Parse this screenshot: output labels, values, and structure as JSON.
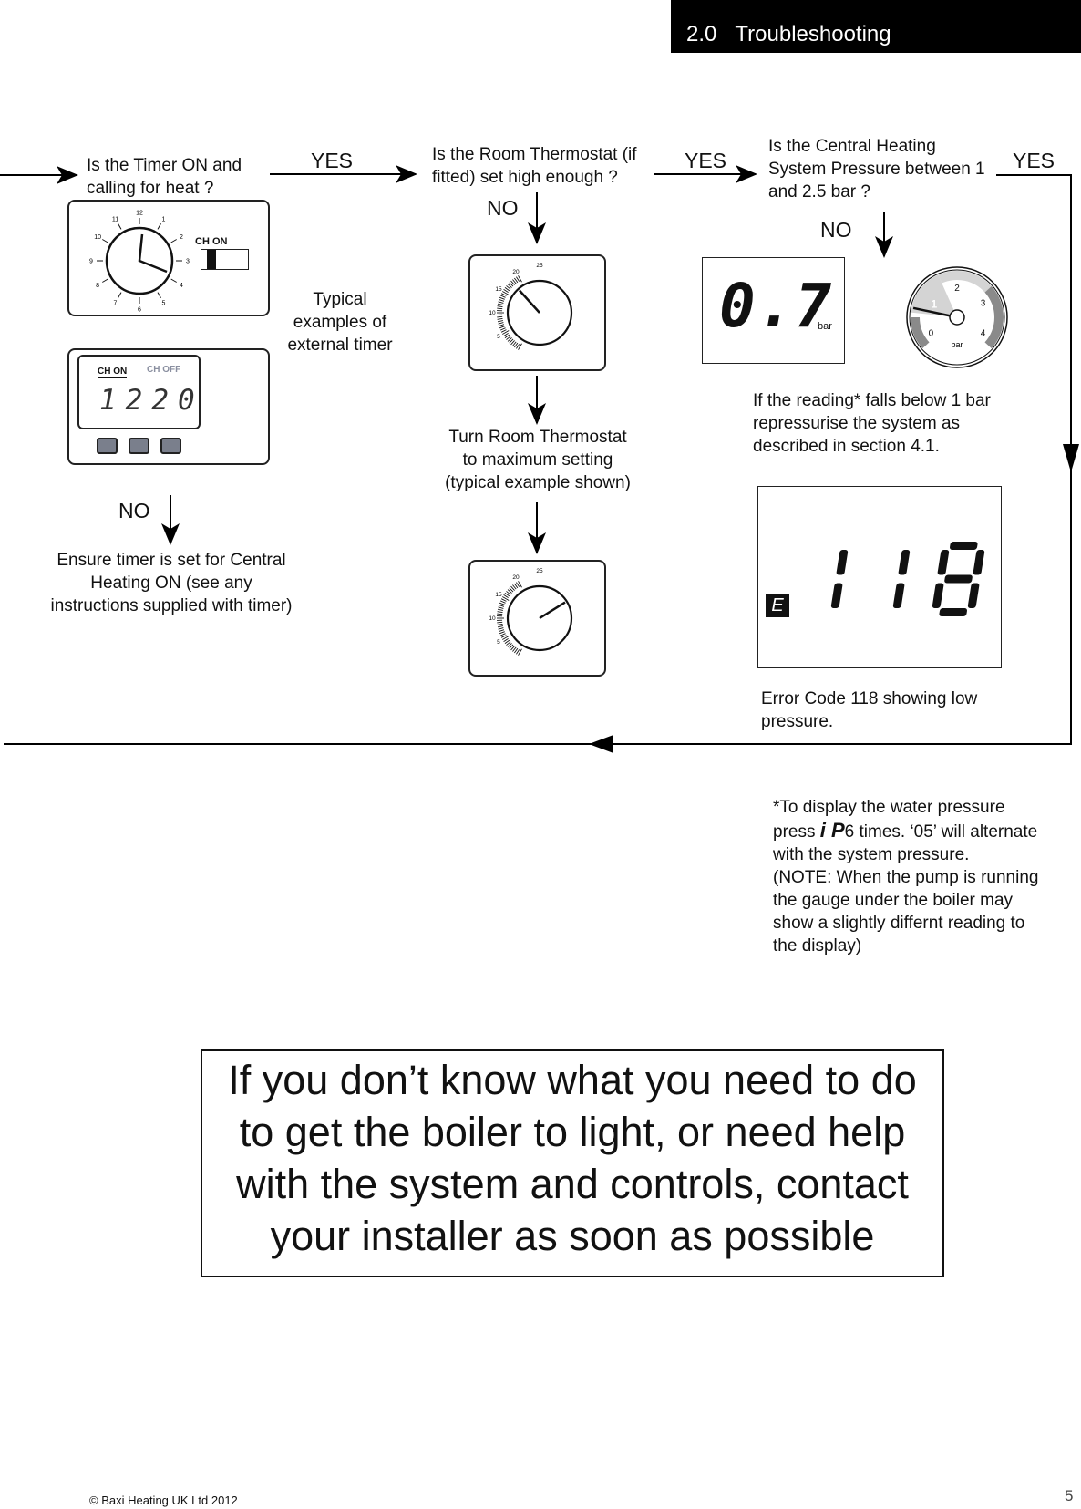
{
  "header": {
    "section": "2.0",
    "title": "Troubleshooting"
  },
  "flow": {
    "yes": "YES",
    "no": "NO",
    "timer": {
      "question": [
        "Is the Timer ON and",
        "calling for heat ?"
      ],
      "caption": [
        "Typical",
        "examples of",
        "external timer"
      ],
      "action": [
        "Ensure timer is set for Central",
        "Heating ON (see any",
        "instructions supplied with timer)"
      ],
      "clock_numbers": [
        "12",
        "1",
        "2",
        "3",
        "4",
        "5",
        "6",
        "7",
        "8",
        "9",
        "10",
        "11"
      ],
      "switch_label": "CH ON",
      "digital": {
        "on_label": "CH ON",
        "off_label": "CH OFF",
        "time": "1220",
        "buttons": 3,
        "button_color": "#7a7f8c"
      }
    },
    "thermostat": {
      "question": [
        "Is the Room Thermostat (if",
        "fitted) set high enough ?"
      ],
      "action": [
        "Turn Room Thermostat",
        "to maximum setting",
        "(typical example shown)"
      ],
      "scale": [
        "5",
        "10",
        "15",
        "20",
        "25"
      ]
    },
    "pressure": {
      "question": [
        "Is the Central Heating",
        "System Pressure between 1",
        "and 2.5 bar ?"
      ],
      "display_value": "0.7",
      "unit": "bar",
      "gauge_labels": [
        "0",
        "1",
        "2",
        "3",
        "4"
      ],
      "gauge_reading_bar": 0.7,
      "advice": [
        "If the reading* falls below 1 bar",
        "repressurise the system as",
        "described in section 4.1."
      ],
      "error_prefix": "E",
      "error_code": "118",
      "error_caption": [
        "Error Code 118 showing low",
        "pressure."
      ],
      "zone_colors": {
        "light": "#d4d4d4",
        "dark": "#8a8a8a"
      }
    }
  },
  "footnote": {
    "line1": "*To display the water pressure",
    "press": "press",
    "keys": "i P",
    "line2_rest": "6 times. ‘05’ will alternate",
    "lines": [
      "with the system pressure.",
      "(NOTE: When the pump is running",
      "the gauge under the boiler may",
      "show a slightly differnt reading to",
      "the display)"
    ]
  },
  "callout": [
    "If you don’t know what you need to do",
    "to get the boiler to light, or need help",
    "with the system and controls, contact",
    "your installer as soon as possible"
  ],
  "footer": {
    "copyright": "© Baxi Heating UK Ltd 2012",
    "page": "5"
  }
}
